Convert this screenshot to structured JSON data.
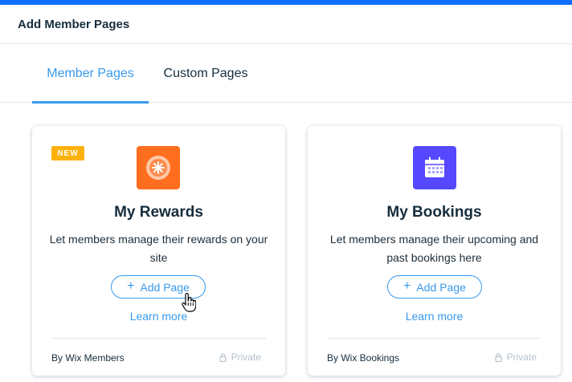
{
  "header": {
    "title": "Add Member Pages"
  },
  "tabs": [
    {
      "label": "Member Pages",
      "active": true
    },
    {
      "label": "Custom Pages",
      "active": false
    }
  ],
  "cards": [
    {
      "badge": "NEW",
      "icon": "rewards-icon",
      "title": "My Rewards",
      "description": "Let members manage their rewards on your site",
      "add_label": "Add Page",
      "learn_more": "Learn more",
      "vendor": "By Wix Members",
      "privacy": "Private"
    },
    {
      "icon": "calendar-icon",
      "title": "My Bookings",
      "description": "Let members manage their upcoming and past bookings here",
      "add_label": "Add Page",
      "learn_more": "Learn more",
      "vendor": "By Wix Bookings",
      "privacy": "Private"
    }
  ],
  "colors": {
    "accent": "#3899ec",
    "top_bar": "#116dff",
    "badge": "#fdb10c",
    "rewards_icon_bg": "#ff6d1f",
    "bookings_icon_bg": "#5548ff"
  }
}
